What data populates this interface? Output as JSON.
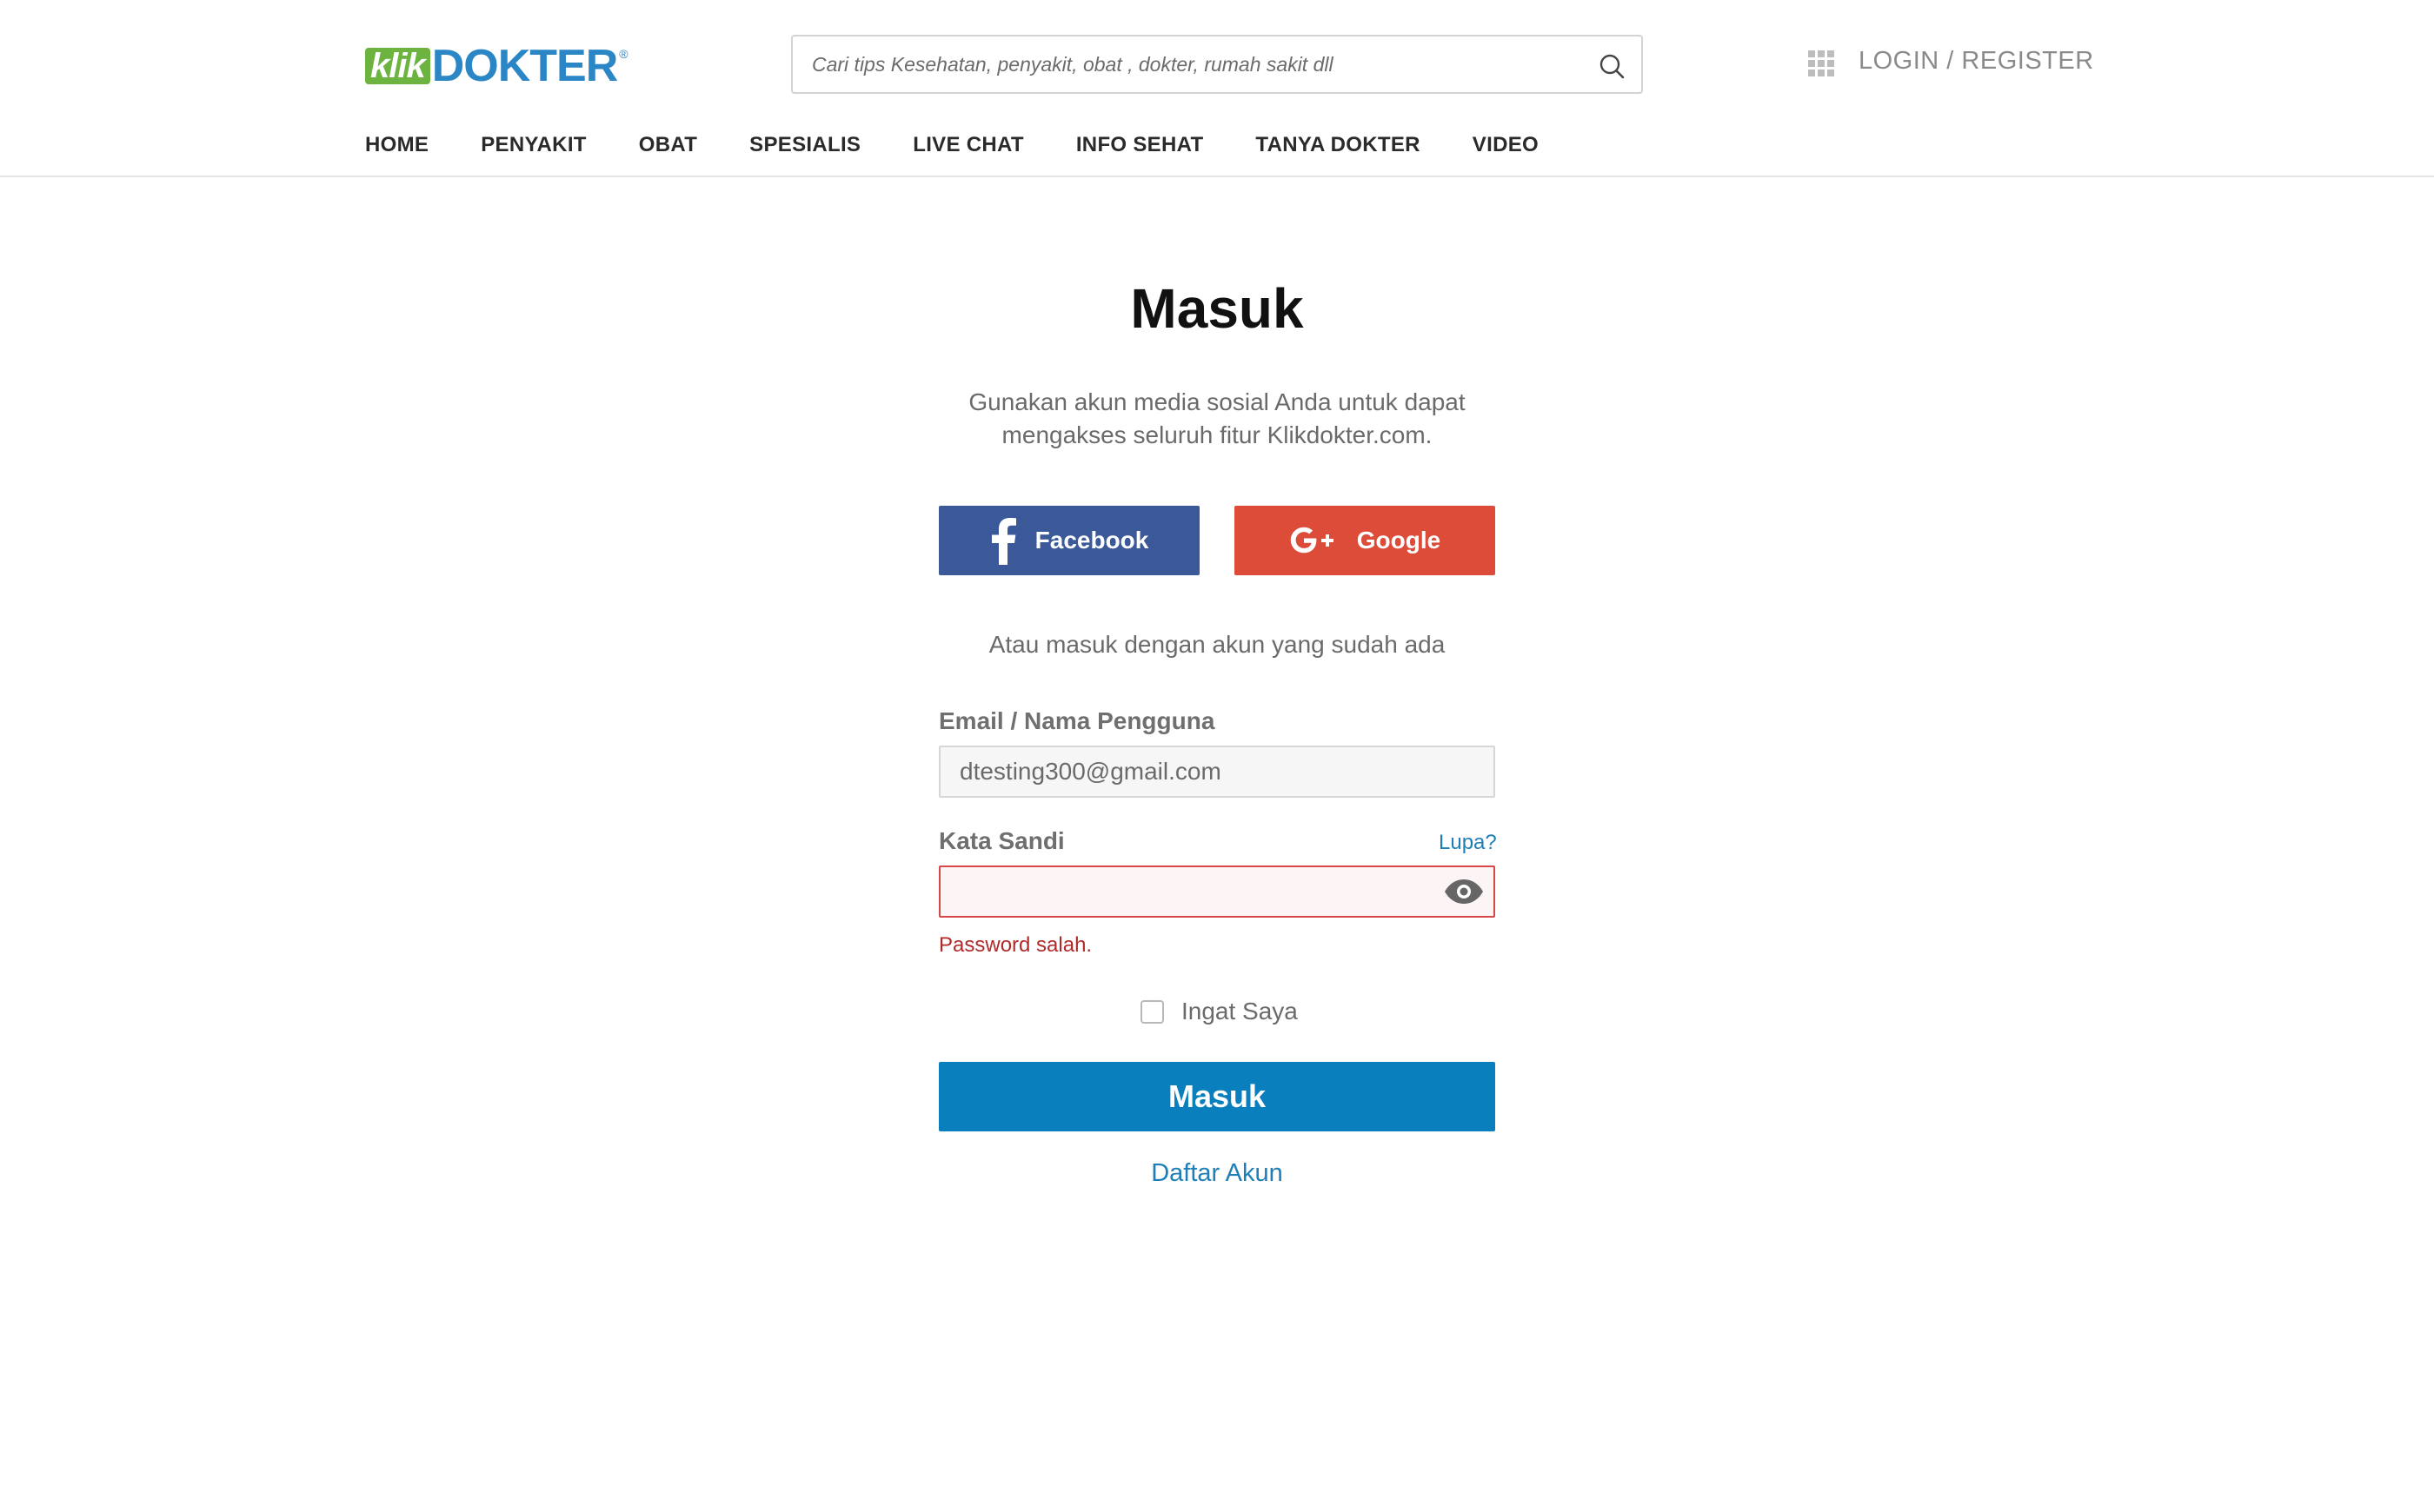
{
  "header": {
    "logo": {
      "part1": "klik",
      "part2": "DOKTER",
      "mark": "®"
    },
    "search": {
      "placeholder": "Cari tips Kesehatan, penyakit, obat , dokter, rumah sakit dll",
      "icon": "search-icon"
    },
    "apps_icon": "grid-icon",
    "login_label": "LOGIN",
    "separator": " / ",
    "register_label": "REGISTER",
    "nav": [
      {
        "label": "HOME"
      },
      {
        "label": "PENYAKIT"
      },
      {
        "label": "OBAT"
      },
      {
        "label": "SPESIALIS"
      },
      {
        "label": "LIVE CHAT"
      },
      {
        "label": "INFO SEHAT"
      },
      {
        "label": "TANYA DOKTER"
      },
      {
        "label": "VIDEO"
      }
    ]
  },
  "login": {
    "title": "Masuk",
    "subtitle": "Gunakan akun media sosial Anda untuk dapat mengakses seluruh fitur Klikdokter.com.",
    "facebook_label": "Facebook",
    "google_label": "Google",
    "alt_text": "Atau masuk dengan akun yang sudah ada",
    "email_label": "Email / Nama Pengguna",
    "email_value": "dtesting300@gmail.com",
    "password_label": "Kata Sandi",
    "forgot_label": "Lupa?",
    "password_value": "",
    "error_text": "Password salah.",
    "remember_label": "Ingat Saya",
    "remember_checked": false,
    "submit_label": "Masuk",
    "register_link": "Daftar Akun"
  },
  "colors": {
    "brand_green": "#6cb33f",
    "brand_blue": "#2b86c5",
    "facebook": "#3b5998",
    "google": "#dd4b39",
    "primary": "#0a7fbd",
    "error": "#b02a2a",
    "link": "#1e7fb8"
  }
}
